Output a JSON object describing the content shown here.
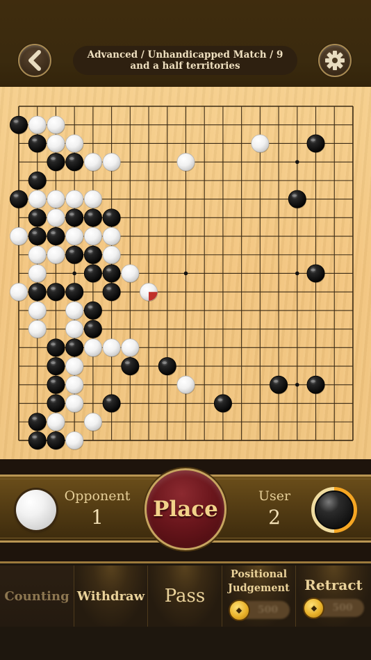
{
  "header": {
    "title_line1": "Advanced / Unhandicapped Match / 9",
    "title_line2": "and a half territories",
    "back_icon": "chevron-left-icon",
    "settings_icon": "gear-icon"
  },
  "board": {
    "size": 19,
    "star_points": [
      [
        3,
        3
      ],
      [
        9,
        3
      ],
      [
        15,
        3
      ],
      [
        3,
        9
      ],
      [
        9,
        9
      ],
      [
        15,
        9
      ],
      [
        3,
        15
      ],
      [
        9,
        15
      ],
      [
        15,
        15
      ]
    ],
    "black": [
      [
        0,
        1
      ],
      [
        1,
        2
      ],
      [
        2,
        3
      ],
      [
        3,
        3
      ],
      [
        16,
        2
      ],
      [
        1,
        4
      ],
      [
        15,
        5
      ],
      [
        0,
        5
      ],
      [
        1,
        6
      ],
      [
        3,
        6
      ],
      [
        4,
        6
      ],
      [
        5,
        6
      ],
      [
        1,
        7
      ],
      [
        2,
        7
      ],
      [
        3,
        8
      ],
      [
        4,
        8
      ],
      [
        4,
        9
      ],
      [
        5,
        9
      ],
      [
        16,
        9
      ],
      [
        1,
        10
      ],
      [
        2,
        10
      ],
      [
        3,
        10
      ],
      [
        5,
        10
      ],
      [
        4,
        11
      ],
      [
        4,
        12
      ],
      [
        2,
        13
      ],
      [
        3,
        13
      ],
      [
        2,
        14
      ],
      [
        6,
        14
      ],
      [
        8,
        14
      ],
      [
        2,
        15
      ],
      [
        14,
        15
      ],
      [
        16,
        15
      ],
      [
        2,
        16
      ],
      [
        5,
        16
      ],
      [
        11,
        16
      ],
      [
        1,
        17
      ],
      [
        1,
        18
      ],
      [
        2,
        18
      ]
    ],
    "white": [
      [
        1,
        1
      ],
      [
        2,
        1
      ],
      [
        2,
        2
      ],
      [
        3,
        2
      ],
      [
        13,
        2
      ],
      [
        4,
        3
      ],
      [
        5,
        3
      ],
      [
        9,
        3
      ],
      [
        1,
        5
      ],
      [
        2,
        5
      ],
      [
        3,
        5
      ],
      [
        4,
        5
      ],
      [
        2,
        6
      ],
      [
        0,
        7
      ],
      [
        3,
        7
      ],
      [
        4,
        7
      ],
      [
        5,
        7
      ],
      [
        1,
        8
      ],
      [
        2,
        8
      ],
      [
        5,
        8
      ],
      [
        1,
        9
      ],
      [
        6,
        9
      ],
      [
        0,
        10
      ],
      [
        7,
        10
      ],
      [
        1,
        11
      ],
      [
        3,
        11
      ],
      [
        1,
        12
      ],
      [
        3,
        12
      ],
      [
        4,
        13
      ],
      [
        5,
        13
      ],
      [
        6,
        13
      ],
      [
        3,
        14
      ],
      [
        3,
        15
      ],
      [
        9,
        15
      ],
      [
        3,
        16
      ],
      [
        2,
        17
      ],
      [
        4,
        17
      ],
      [
        3,
        18
      ]
    ],
    "last_move": {
      "color": "white",
      "point": [
        7,
        10
      ],
      "marker_color": "#c0302a"
    }
  },
  "players": {
    "opponent": {
      "label": "Opponent",
      "count": "1",
      "stone": "white"
    },
    "user": {
      "label": "User",
      "count": "2",
      "stone": "black",
      "timer_remaining": 0.5,
      "timer_color": "#f5a623"
    }
  },
  "place_button": {
    "label": "Place"
  },
  "toolbar": {
    "counting": "Counting",
    "withdraw": "Withdraw",
    "pass": "Pass",
    "judgement_line1": "Positional",
    "judgement_line2": "Judgement",
    "judgement_cost": "500",
    "retract": "Retract",
    "retract_cost": "500",
    "coin_icon": "coin-icon"
  },
  "colors": {
    "board": "#f3c57f",
    "grid": "#3a2a14",
    "accent_gold": "#c7a560",
    "place_red": "#6a161c"
  }
}
